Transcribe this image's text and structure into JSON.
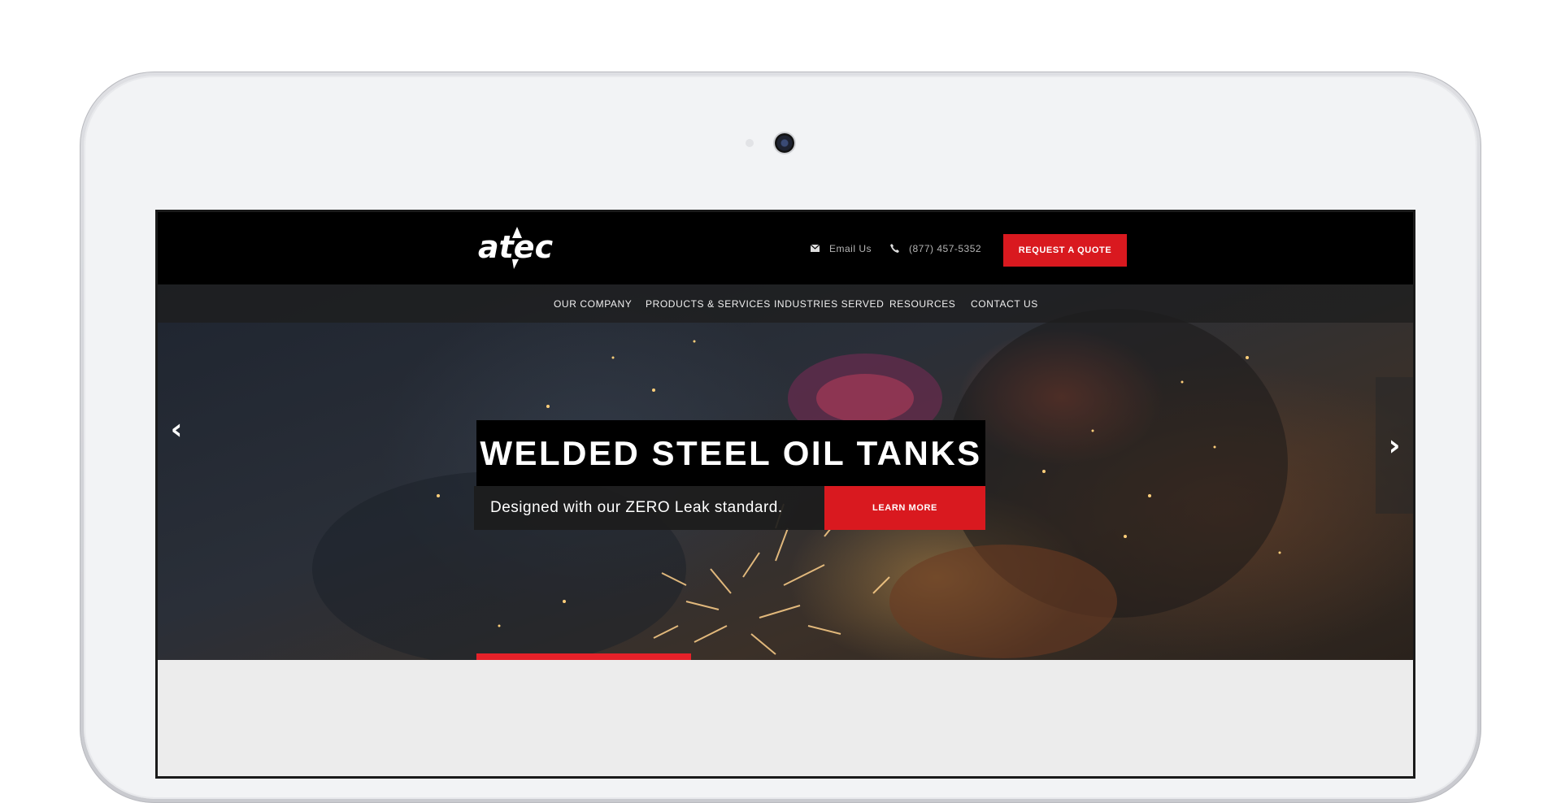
{
  "site": {
    "logo_text": "atec",
    "topbar": {
      "email_label": "Email Us",
      "phone_label": "(877) 457-5352",
      "quote_button": "REQUEST A QUOTE"
    },
    "nav": {
      "items": [
        {
          "label": "OUR COMPANY"
        },
        {
          "label": "PRODUCTS & SERVICES"
        },
        {
          "label": "INDUSTRIES SERVED"
        },
        {
          "label": "RESOURCES"
        },
        {
          "label": "CONTACT US"
        }
      ]
    },
    "hero": {
      "headline": "WELDED STEEL OIL TANKS",
      "subtext": "Designed with our ZERO Leak standard.",
      "cta_label": "LEARN MORE",
      "prev_arrow": "‹",
      "next_arrow": "›"
    }
  },
  "colors": {
    "brand_red": "#d9191f",
    "header_bg": "#000000"
  },
  "icons": [
    "email-icon",
    "phone-icon",
    "chevron-left-icon",
    "chevron-right-icon",
    "camera-icon"
  ]
}
